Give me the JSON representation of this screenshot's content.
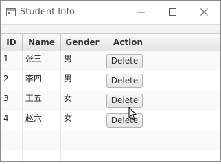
{
  "window": {
    "title": "Student Info",
    "app_icon": "window-icon",
    "controls": [
      "minimize-icon",
      "maximize-icon",
      "close-icon"
    ]
  },
  "table": {
    "columns": [
      "ID",
      "Name",
      "Gender",
      "Action"
    ],
    "rows": [
      {
        "id": "1",
        "name": "张三",
        "gender": "男",
        "action": "Delete"
      },
      {
        "id": "2",
        "name": "李四",
        "gender": "男",
        "action": "Delete"
      },
      {
        "id": "3",
        "name": "王五",
        "gender": "女",
        "action": "Delete"
      },
      {
        "id": "4",
        "name": "赵六",
        "gender": "女",
        "action": "Delete"
      }
    ]
  },
  "pointer": "arrow-cursor-icon"
}
